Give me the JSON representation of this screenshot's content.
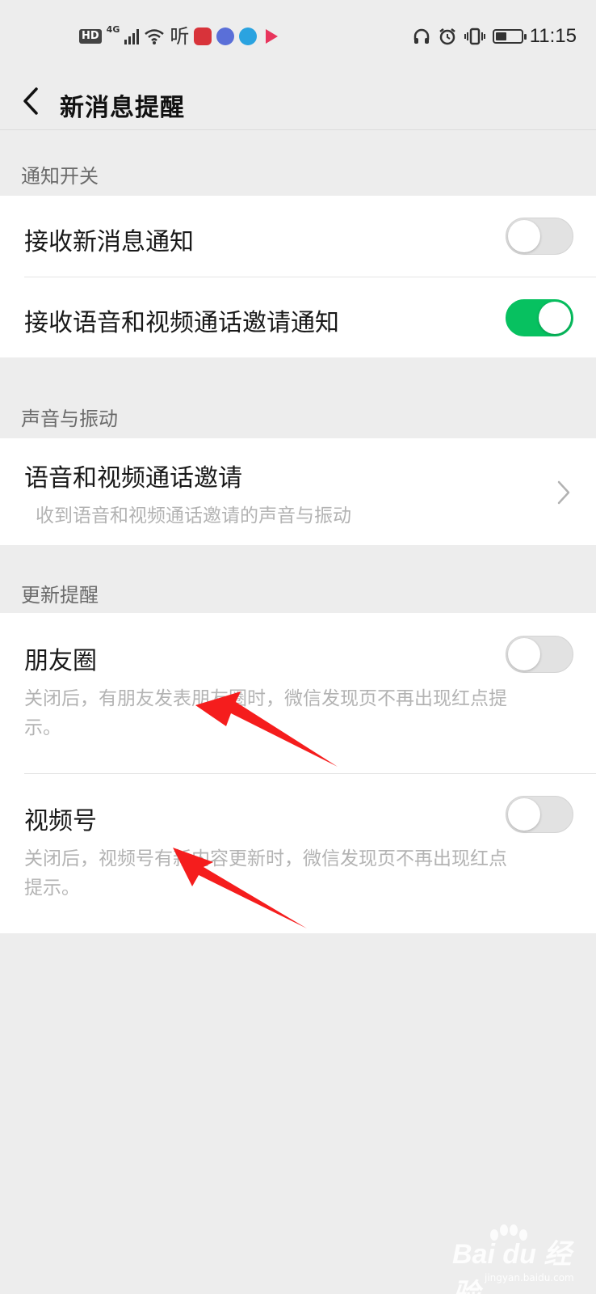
{
  "status_bar": {
    "hd_badge": "HD",
    "network": "4G",
    "ting": "听",
    "time": "11:15",
    "battery_level": 0.45,
    "icons": [
      "signal-icon",
      "wifi-icon",
      "book-app-icon",
      "music-app-icon",
      "browser-app-icon",
      "video-app-icon",
      "headphones-icon",
      "alarm-icon",
      "vibrate-icon",
      "battery-icon"
    ]
  },
  "nav": {
    "title": "新消息提醒",
    "back_icon": "chevron-left-icon"
  },
  "sections": [
    {
      "title": "通知开关",
      "rows": [
        {
          "label": "接收新消息通知",
          "toggle_on": false
        },
        {
          "label": "接收语音和视频通话邀请通知",
          "toggle_on": true
        }
      ]
    },
    {
      "title": "声音与振动",
      "rows": [
        {
          "label": "语音和视频通话邀请",
          "subtitle": "收到语音和视频通话邀请的声音与振动",
          "chevron_icon": "chevron-right-icon"
        }
      ]
    },
    {
      "title": "更新提醒",
      "rows": [
        {
          "label": "朋友圈",
          "subtitle_line1": "关闭后，有朋友发表朋友圈时，微信发现页不再出现红点提",
          "subtitle_line2": "示。",
          "toggle_on": false
        },
        {
          "label": "视频号",
          "subtitle_line1": "关闭后，视频号有新内容更新时，微信发现页不再出现红点",
          "subtitle_line2": "提示。",
          "toggle_on": false
        }
      ]
    }
  ],
  "colors": {
    "background": "#ededed",
    "card": "#ffffff",
    "toggle_on": "#07c160",
    "toggle_off": "#e2e2e2",
    "annotation_arrow": "#f51d1d"
  },
  "watermark": {
    "text": "Bai du 经验",
    "url": "jingyan.baidu.com"
  }
}
